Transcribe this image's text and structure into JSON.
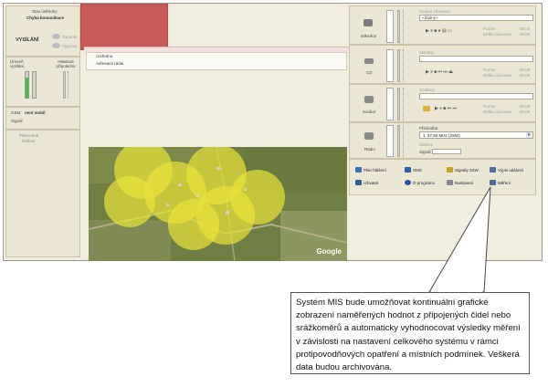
{
  "status": {
    "heading": "Stav ústředny",
    "value": "Chyba komunikace",
    "transmit_label": "VYSÍLÁNÍ",
    "on_label": "Zapnout",
    "off_label": "Vypnout"
  },
  "levels": {
    "broadcast_level_label": "Úroveň vysílání",
    "volume_label": "Hlasitost přípolechu"
  },
  "gsm": {
    "gsm_label": "GSM",
    "gsm_value": "není mobil",
    "signal_label": "Signál"
  },
  "planned": {
    "line1": "Plánované",
    "line2": "hlášení"
  },
  "mid": {
    "row1": "Ústředna",
    "row2": "Adresace rádia"
  },
  "sources": {
    "mic": {
      "label": "Mikrofon",
      "combo_label": "Soubor záznamu",
      "combo_value": "<Žádný>",
      "pos_label": "Pozice",
      "pos_value": "00:00",
      "len_label": "Délka záznamu",
      "len_value": "00:00"
    },
    "cd": {
      "label": "CD",
      "combo_label": "Skladby",
      "pos_label": "Pozice",
      "pos_value": "00:00",
      "len_label": "Délka záznamu",
      "len_value": "00:00"
    },
    "file": {
      "label": "Soubor",
      "combo_label": "Soubory",
      "pos_label": "Pozice",
      "pos_value": "00:00",
      "len_label": "Délka záznamu",
      "len_value": "00:00"
    },
    "radio": {
      "label": "Rádio",
      "combo_label": "Předvolba",
      "combo_value": "1.   87,50 MHz   (3SW)",
      "freq_label": "Stanice",
      "signal_label": "Signál"
    }
  },
  "menu": {
    "items": [
      {
        "label": "Plán hlášení",
        "icon": "calendar-icon",
        "color": "#3a6fb5"
      },
      {
        "label": "SMS",
        "icon": "sms-icon",
        "color": "#2e5aa8"
      },
      {
        "label": "Signály 3SW",
        "icon": "signals-icon",
        "color": "#c7a21c"
      },
      {
        "label": "Výpis událostí",
        "icon": "event-log-icon",
        "color": "#4f6f99"
      },
      {
        "label": "Uživatel",
        "icon": "user-icon",
        "color": "#2c5d9c"
      },
      {
        "label": "O programu",
        "icon": "info-icon",
        "color": "#2650a0"
      },
      {
        "label": "Nastavení",
        "icon": "settings-icon",
        "color": "#888888"
      },
      {
        "label": "Měření",
        "icon": "measurement-icon",
        "color": "#4f6f99"
      }
    ]
  },
  "map": {
    "watermark": "Google"
  },
  "callout": {
    "text": "Systém MIS bude umožňovat kontinuální grafické zobrazení naměřených hodnot z připojených čidel nebo srážkoměrů a automaticky vyhodnocovat výsledky měření v závislosti na nastavení celkového systému v rámci protipovodňových opatření a místních podmínek. Veškerá data budou archivována."
  },
  "colors": {
    "red_block": "#c85a5a",
    "coverage": "#e6e23a",
    "app_bg": "#f1eddf"
  }
}
